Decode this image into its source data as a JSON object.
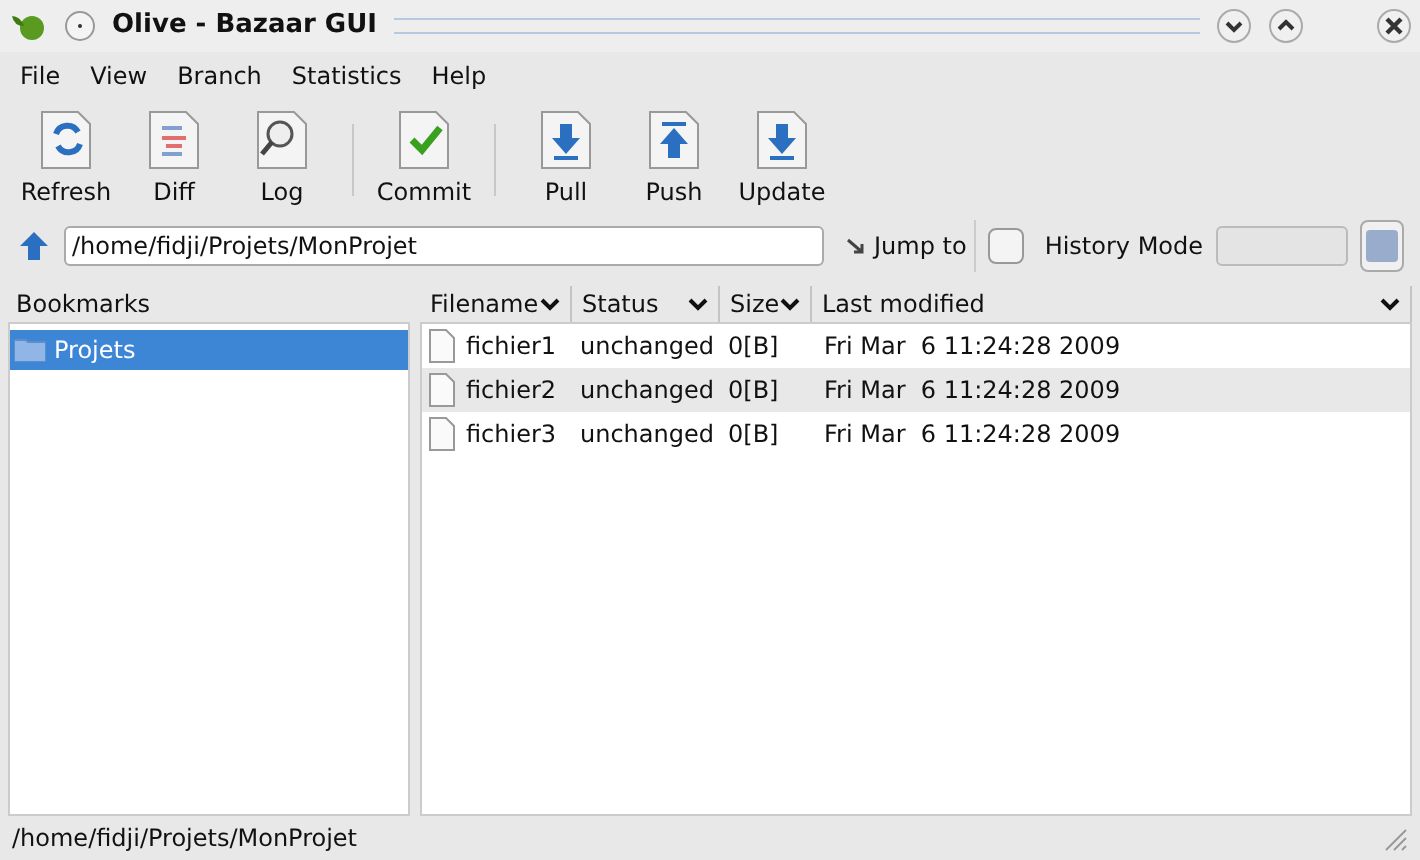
{
  "window": {
    "title": "Olive - Bazaar GUI"
  },
  "menu": [
    "File",
    "View",
    "Branch",
    "Statistics",
    "Help"
  ],
  "toolbar": [
    {
      "kind": "refresh",
      "label": "Refresh"
    },
    {
      "kind": "diff",
      "label": "Diff"
    },
    {
      "kind": "log",
      "label": "Log"
    },
    {
      "kind": "separator"
    },
    {
      "kind": "commit",
      "label": "Commit"
    },
    {
      "kind": "separator"
    },
    {
      "kind": "pull",
      "label": "Pull"
    },
    {
      "kind": "push",
      "label": "Push"
    },
    {
      "kind": "update",
      "label": "Update"
    }
  ],
  "location": {
    "value": "/home/fidji/Projets/MonProjet",
    "jump": "Jump to",
    "history_mode": {
      "label": "History Mode",
      "checked": false
    }
  },
  "bookmarks": {
    "header": "Bookmarks",
    "items": [
      {
        "label": "Projets",
        "selected": true
      }
    ]
  },
  "files": {
    "columns": [
      "Filename",
      "Status",
      "Size",
      "Last modified"
    ],
    "rows": [
      {
        "name": "fichier1",
        "status": "unchanged",
        "size": "0[B]",
        "modified": "Fri Mar  6 11:24:28 2009"
      },
      {
        "name": "fichier2",
        "status": "unchanged",
        "size": "0[B]",
        "modified": "Fri Mar  6 11:24:28 2009"
      },
      {
        "name": "fichier3",
        "status": "unchanged",
        "size": "0[B]",
        "modified": "Fri Mar  6 11:24:28 2009"
      }
    ]
  },
  "status_bar": "/home/fidji/Projets/MonProjet"
}
